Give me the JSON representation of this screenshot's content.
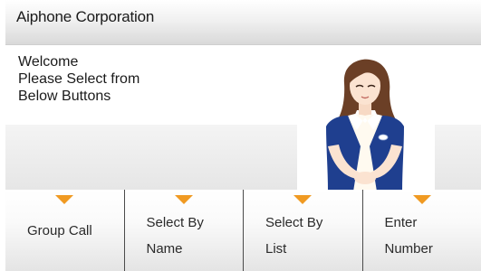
{
  "header": {
    "title": "Aiphone Corporation"
  },
  "welcome": {
    "lines": [
      "Welcome",
      "Please Select from",
      "Below Buttons"
    ]
  },
  "illustration": {
    "icon": "receptionist-illustration"
  },
  "buttons": [
    {
      "lines": [
        "Group Call"
      ]
    },
    {
      "lines": [
        "Select By",
        "Name"
      ]
    },
    {
      "lines": [
        "Select By",
        "List"
      ]
    },
    {
      "lines": [
        "Enter",
        "Number"
      ]
    }
  ],
  "colors": {
    "marker": "#f09a22",
    "divider": "#4b4b4b",
    "vest": "#1f3f8f"
  }
}
